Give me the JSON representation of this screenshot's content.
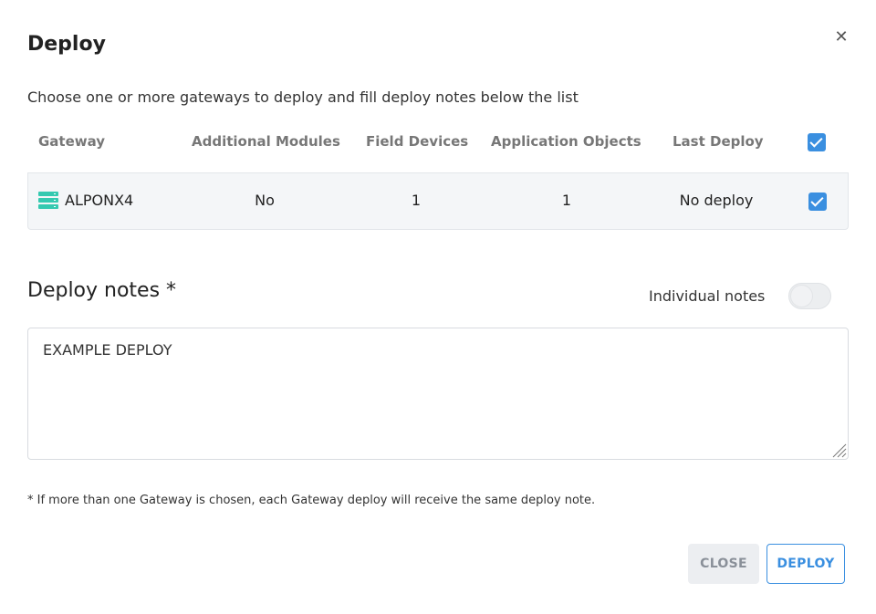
{
  "dialog": {
    "title": "Deploy",
    "close_icon": "close-icon",
    "subtitle": "Choose one or more gateways to deploy and fill deploy notes below the list"
  },
  "table": {
    "columns": [
      "Gateway",
      "Additional Modules",
      "Field Devices",
      "Application Objects",
      "Last Deploy"
    ],
    "select_all_checked": true,
    "rows": [
      {
        "icon": "server-icon",
        "gateway": "ALPONX4",
        "additional_modules": "No",
        "field_devices": "1",
        "application_objects": "1",
        "last_deploy": "No deploy",
        "checked": true
      }
    ]
  },
  "notes": {
    "title": "Deploy notes *",
    "individual_label": "Individual notes",
    "individual_enabled": false,
    "value": "EXAMPLE DEPLOY",
    "footnote": "* If more than one Gateway is chosen, each Gateway deploy will receive the same deploy note."
  },
  "actions": {
    "close_label": "CLOSE",
    "deploy_label": "DEPLOY"
  },
  "colors": {
    "accent": "#3a8fe0",
    "gateway_icon": "#34c9b0"
  }
}
